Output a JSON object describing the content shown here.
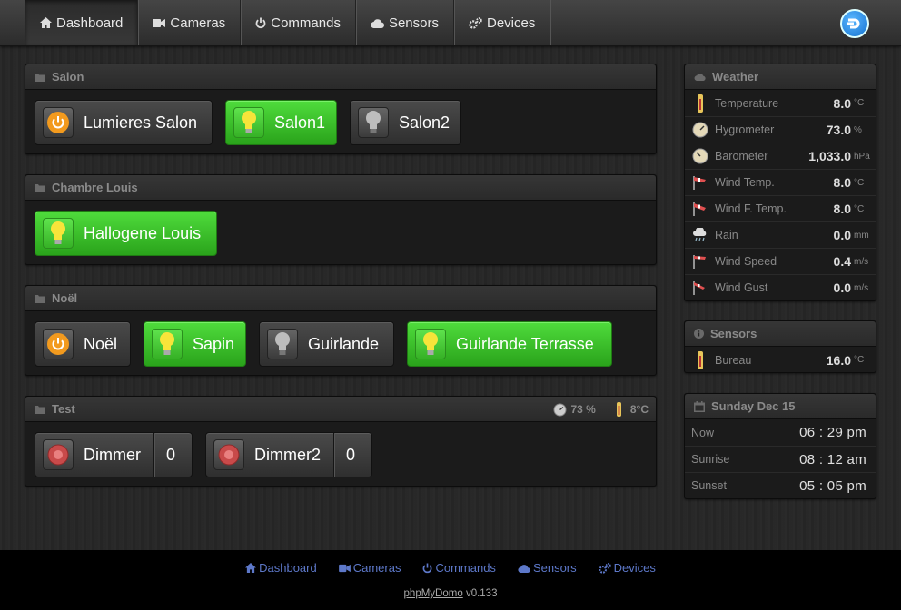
{
  "nav": {
    "items": [
      {
        "label": "Dashboard",
        "icon": "home-icon"
      },
      {
        "label": "Cameras",
        "icon": "video-camera-icon"
      },
      {
        "label": "Commands",
        "icon": "power-icon"
      },
      {
        "label": "Sensors",
        "icon": "cloud-icon"
      },
      {
        "label": "Devices",
        "icon": "cogs-icon"
      }
    ],
    "active": "Dashboard"
  },
  "rooms": [
    {
      "title": "Salon",
      "buttons": [
        {
          "label": "Lumieres Salon",
          "icon": "power-icon",
          "state": "gray"
        },
        {
          "label": "Salon1",
          "icon": "bulb-on-icon",
          "state": "green"
        },
        {
          "label": "Salon2",
          "icon": "bulb-off-icon",
          "state": "gray"
        }
      ]
    },
    {
      "title": "Chambre Louis",
      "buttons": [
        {
          "label": "Hallogene Louis",
          "icon": "bulb-on-icon",
          "state": "green"
        }
      ]
    },
    {
      "title": "Noël",
      "buttons": [
        {
          "label": "Noël",
          "icon": "power-icon",
          "state": "gray"
        },
        {
          "label": "Sapin",
          "icon": "bulb-on-icon",
          "state": "green"
        },
        {
          "label": "Guirlande",
          "icon": "bulb-off-icon",
          "state": "gray"
        },
        {
          "label": "Guirlande Terrasse",
          "icon": "bulb-on-icon",
          "state": "green"
        }
      ]
    },
    {
      "title": "Test",
      "humidity": "73 %",
      "temperature": "8°C",
      "buttons": [
        {
          "label": "Dimmer",
          "value": "0",
          "icon": "dimmer-icon",
          "state": "gray"
        },
        {
          "label": "Dimmer2",
          "value": "0",
          "icon": "dimmer-icon",
          "state": "gray"
        }
      ]
    }
  ],
  "weather": {
    "title": "Weather",
    "rows": [
      {
        "label": "Temperature",
        "value": "8.0",
        "unit": "°C",
        "icon": "thermometer-icon"
      },
      {
        "label": "Hygrometer",
        "value": "73.0",
        "unit": "%",
        "icon": "hygrometer-icon"
      },
      {
        "label": "Barometer",
        "value": "1,033.0",
        "unit": "hPa",
        "icon": "barometer-icon"
      },
      {
        "label": "Wind Temp.",
        "value": "8.0",
        "unit": "°C",
        "icon": "windsock-icon"
      },
      {
        "label": "Wind F. Temp.",
        "value": "8.0",
        "unit": "°C",
        "icon": "windsock-icon"
      },
      {
        "label": "Rain",
        "value": "0.0",
        "unit": "mm",
        "icon": "rain-cloud-icon"
      },
      {
        "label": "Wind Speed",
        "value": "0.4",
        "unit": "m/s",
        "icon": "windsock-icon"
      },
      {
        "label": "Wind Gust",
        "value": "0.0",
        "unit": "m/s",
        "icon": "windsock-icon"
      }
    ]
  },
  "sensors": {
    "title": "Sensors",
    "rows": [
      {
        "label": "Bureau",
        "value": "16.0",
        "unit": "°C",
        "icon": "thermometer-icon"
      }
    ]
  },
  "calendar": {
    "title": "Sunday Dec 15",
    "rows": [
      {
        "label": "Now",
        "value": "06 : 29 pm"
      },
      {
        "label": "Sunrise",
        "value": "08 : 12 am"
      },
      {
        "label": "Sunset",
        "value": "05 : 05 pm"
      }
    ]
  },
  "footer": {
    "links": [
      "Dashboard",
      "Cameras",
      "Commands",
      "Sensors",
      "Devices"
    ],
    "app_name": "phpMyDomo",
    "version": "v0.133"
  },
  "colors": {
    "accent_green": "#2fb520",
    "link_blue": "#5d78c9",
    "bulb_yellow": "#f7e43a",
    "power_orange": "#f29a1e"
  }
}
